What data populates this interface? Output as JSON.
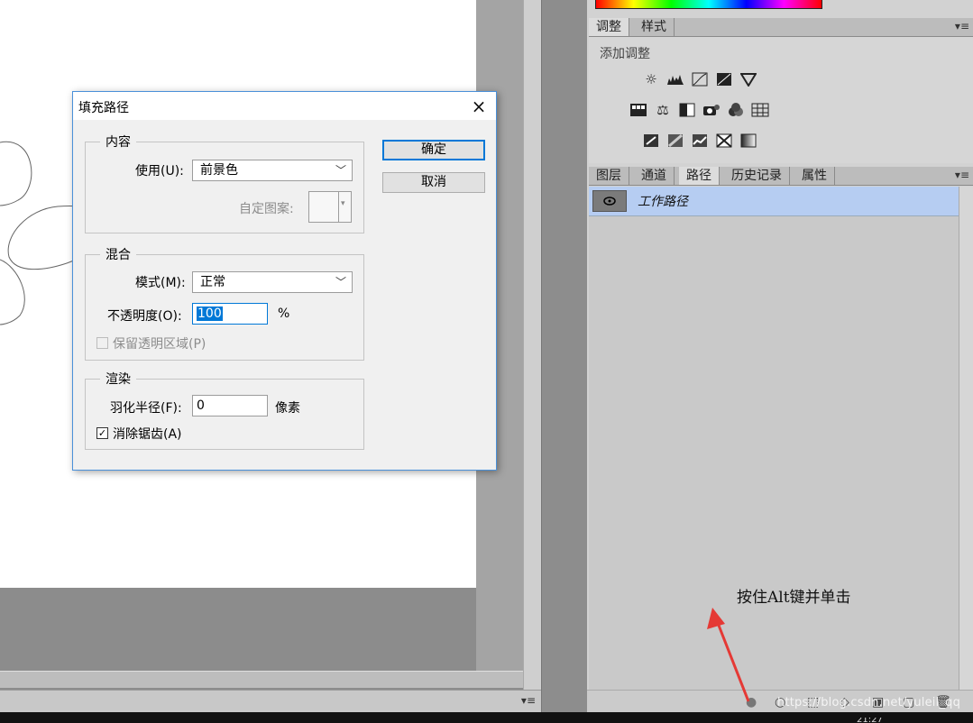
{
  "dialog": {
    "title": "填充路径",
    "close_icon": "×",
    "content_group": {
      "legend": "内容",
      "use_label": "使用(U):",
      "use_value": "前景色",
      "custom_pattern_label": "自定图案:"
    },
    "blend_group": {
      "legend": "混合",
      "mode_label": "模式(M):",
      "mode_value": "正常",
      "opacity_label": "不透明度(O):",
      "opacity_value": "100",
      "opacity_unit": "%",
      "preserve_transparency_label": "保留透明区域(P)",
      "preserve_transparency_checked": false
    },
    "render_group": {
      "legend": "渲染",
      "feather_label": "羽化半径(F):",
      "feather_value": "0",
      "feather_unit": "像素",
      "antialias_label": "消除锯齿(A)",
      "antialias_checked": true
    },
    "ok_label": "确定",
    "cancel_label": "取消"
  },
  "adjustments_panel": {
    "tabs": [
      "调整",
      "样式"
    ],
    "active_tab": "调整",
    "add_adjustment_label": "添加调整",
    "icon_rows": [
      [
        "brightness-icon",
        "levels-icon",
        "curves-icon",
        "exposure-icon",
        "vibrance-icon"
      ],
      [
        "hue-saturation-icon",
        "color-balance-icon",
        "black-white-icon",
        "photo-filter-icon",
        "channel-mixer-icon",
        "color-lookup-icon"
      ],
      [
        "invert-icon",
        "posterize-icon",
        "threshold-icon",
        "selective-color-icon",
        "gradient-map-icon"
      ]
    ]
  },
  "layers_panel": {
    "tabs": [
      "图层",
      "通道",
      "路径",
      "历史记录",
      "属性"
    ],
    "active_tab": "路径",
    "path_name": "工作路径"
  },
  "annotation": "按住Alt键并单击",
  "watermark": "https://blog.csdn.net/yuleil_qq",
  "clock": "21:27",
  "colors": {
    "selection_blue": "#b6cdf2",
    "dialog_border": "#4a90d9",
    "default_button_border": "#0078d7",
    "annotation_arrow": "#e53935"
  }
}
